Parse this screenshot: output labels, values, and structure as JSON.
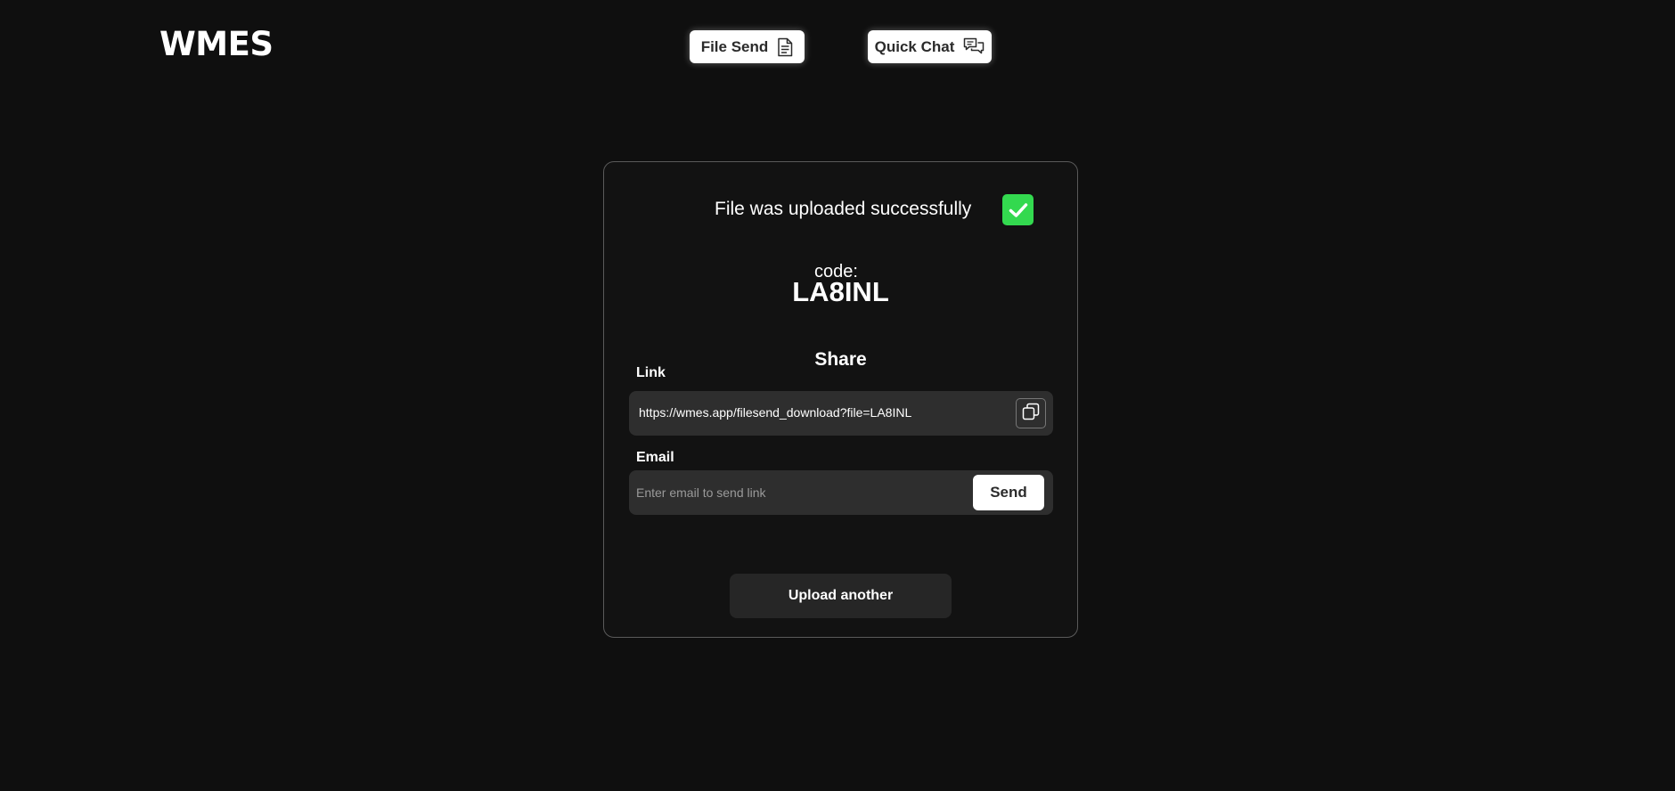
{
  "header": {
    "logo": "WMES",
    "nav": [
      {
        "label": "File Send",
        "icon": "document-icon"
      },
      {
        "label": "Quick Chat",
        "icon": "chat-bubbles-icon"
      }
    ]
  },
  "card": {
    "success_message": "File was uploaded successfully",
    "success_icon": "checkmark-icon",
    "success_color": "#33d94f",
    "code_label": "code:",
    "code_value": "LA8INL",
    "share_title": "Share",
    "link": {
      "label": "Link",
      "value": "https://wmes.app/filesend_download?file=LA8INL",
      "copy_icon": "copy-icon"
    },
    "email": {
      "label": "Email",
      "placeholder": "Enter email to send link",
      "value": "",
      "send_label": "Send"
    },
    "upload_another_label": "Upload another"
  }
}
